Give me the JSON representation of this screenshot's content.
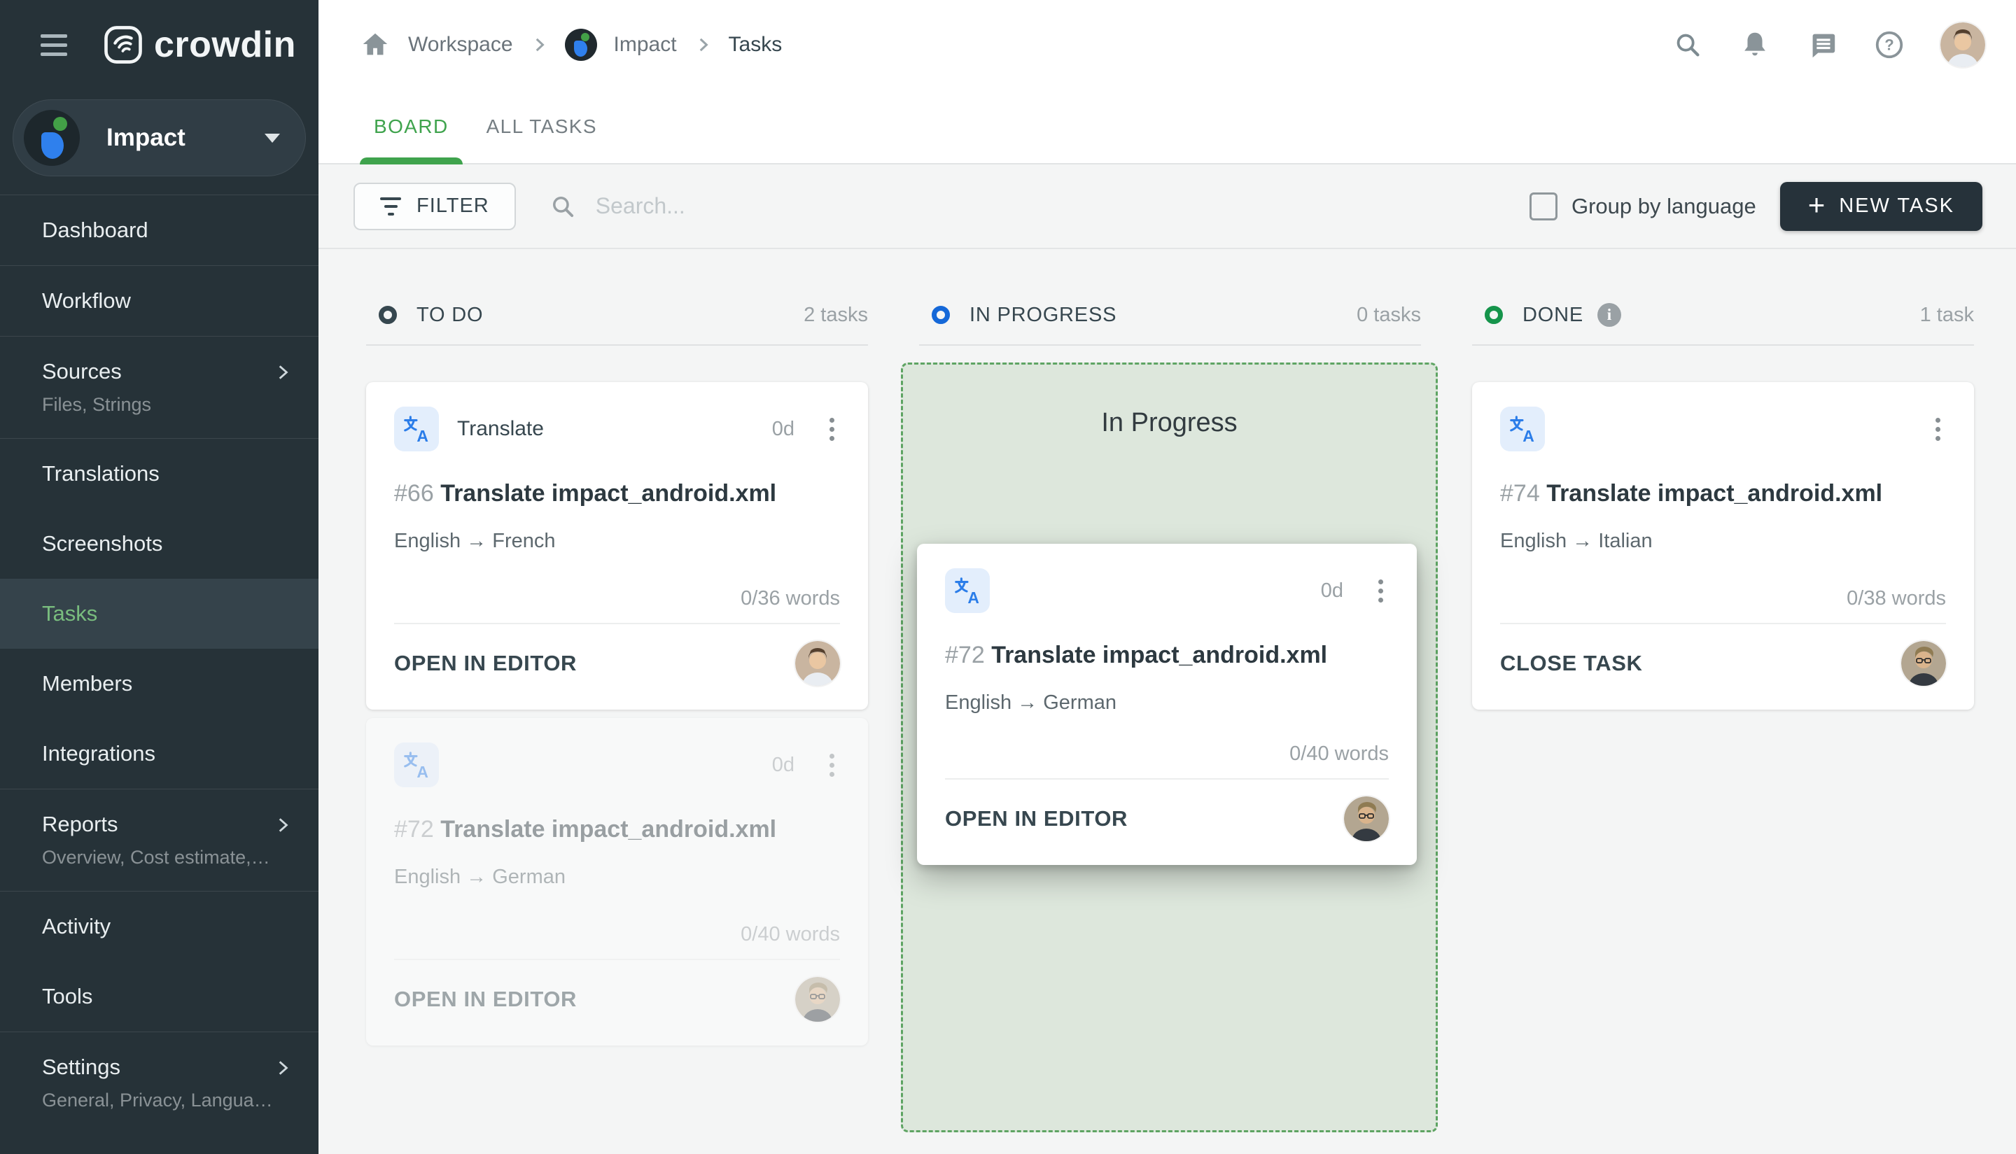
{
  "app": {
    "brand": "crowdin"
  },
  "topbar": {
    "breadcrumb": {
      "workspace": "Workspace",
      "project": "Impact",
      "page": "Tasks"
    }
  },
  "tabs": {
    "board": "BOARD",
    "all_tasks": "ALL TASKS"
  },
  "toolbar": {
    "filter": "FILTER",
    "search_placeholder": "Search...",
    "group_by_language": "Group by language",
    "new_task": "NEW TASK"
  },
  "sidebar": {
    "project": "Impact",
    "items": [
      {
        "label": "Dashboard"
      },
      {
        "label": "Workflow"
      },
      {
        "label": "Sources",
        "sub": "Files, Strings"
      },
      {
        "label": "Translations"
      },
      {
        "label": "Screenshots"
      },
      {
        "label": "Tasks",
        "active": true
      },
      {
        "label": "Members"
      },
      {
        "label": "Integrations"
      },
      {
        "label": "Reports",
        "sub": "Overview, Cost estimate, Transl…"
      },
      {
        "label": "Activity"
      },
      {
        "label": "Tools"
      },
      {
        "label": "Settings",
        "sub": "General, Privacy, Languages, Q…"
      }
    ]
  },
  "board": {
    "columns": [
      {
        "name": "TO DO",
        "count": "2 tasks",
        "accent": "#36474f"
      },
      {
        "name": "IN PROGRESS",
        "count": "0 tasks",
        "accent": "#1568d8",
        "dropzone_label": "In Progress"
      },
      {
        "name": "DONE",
        "count": "1 task",
        "accent": "#15944b"
      }
    ],
    "cards": {
      "todo1": {
        "type": "Translate",
        "due": "0d",
        "id": "#66",
        "title": "Translate impact_android.xml",
        "languages": "English → French",
        "words": "0/36 words",
        "action": "OPEN IN EDITOR"
      },
      "todo2": {
        "due": "0d",
        "id": "#72",
        "title": "Translate impact_android.xml",
        "languages": "English → German",
        "words": "0/40 words",
        "action": "OPEN IN EDITOR"
      },
      "dragging": {
        "due": "0d",
        "id": "#72",
        "title": "Translate impact_android.xml",
        "languages": "English → German",
        "words": "0/40 words",
        "action": "OPEN IN EDITOR"
      },
      "done1": {
        "id": "#74",
        "title": "Translate impact_android.xml",
        "languages": "English → Italian",
        "words": "0/38 words",
        "action": "CLOSE TASK"
      }
    }
  },
  "colors": {
    "sidebar_bg": "#263238",
    "accent_green": "#3fa34d",
    "sidebar_active_green": "#79bd7e",
    "todo_circle": "#36474f",
    "inprogress_circle": "#1568d8",
    "done_circle": "#15944b",
    "dropzone_bg": "#dde7dc",
    "dropzone_border": "#5ea463",
    "newtask_bg": "#26323a",
    "translate_icon_blue": "#2b7de9"
  }
}
